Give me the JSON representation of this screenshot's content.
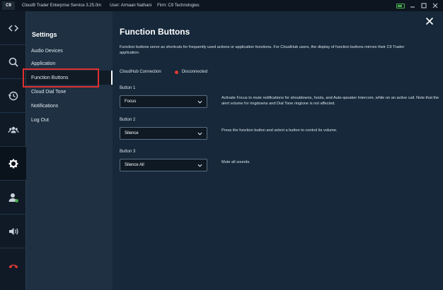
{
  "titlebar": {
    "logo": "C9",
    "app": "Cloud9 Trader Enterprise Service  3.25.0m",
    "user": "User: Armaan Nathani",
    "firm": "Firm: C9 Technologies"
  },
  "rail": {
    "items": [
      "code-icon",
      "search-icon",
      "history-icon",
      "contacts-icon",
      "settings-icon",
      "user-status-icon",
      "volume-icon",
      "hangup-icon"
    ],
    "active": "settings-icon"
  },
  "settings": {
    "title": "Settings",
    "items": [
      {
        "label": "Audio Devices"
      },
      {
        "label": "Application"
      },
      {
        "label": "Function Buttons"
      },
      {
        "label": "Cloud Dial Tone"
      },
      {
        "label": "Notifications"
      },
      {
        "label": "Log Out"
      }
    ],
    "active_index": 2
  },
  "main": {
    "title": "Function Buttons",
    "description": "Function buttons serve as shortcuts for frequently used actions or application functions. For CloudHub users, the display of function buttons mirrors their C9 Trader application.",
    "connection_label": "CloudHub Connection",
    "connection_status": "Disconnected",
    "buttons": [
      {
        "label": "Button 1",
        "value": "Focus",
        "help": "Activate Focus to mute notifications for shoutdowns, hoots, and Auto-speaker Intercom, while on an active call. Note that the alert volume for ringdowns and Dial Tone ringtone is not affected."
      },
      {
        "label": "Button 2",
        "value": "Silence",
        "help": "Press the function button and select a button to control its volume."
      },
      {
        "label": "Button 3",
        "value": "Silence All",
        "help": "Mute all sounds."
      }
    ]
  },
  "colors": {
    "status_disconnected": "#e53935",
    "highlight_box": "#e03030",
    "battery": "#4caf50"
  }
}
